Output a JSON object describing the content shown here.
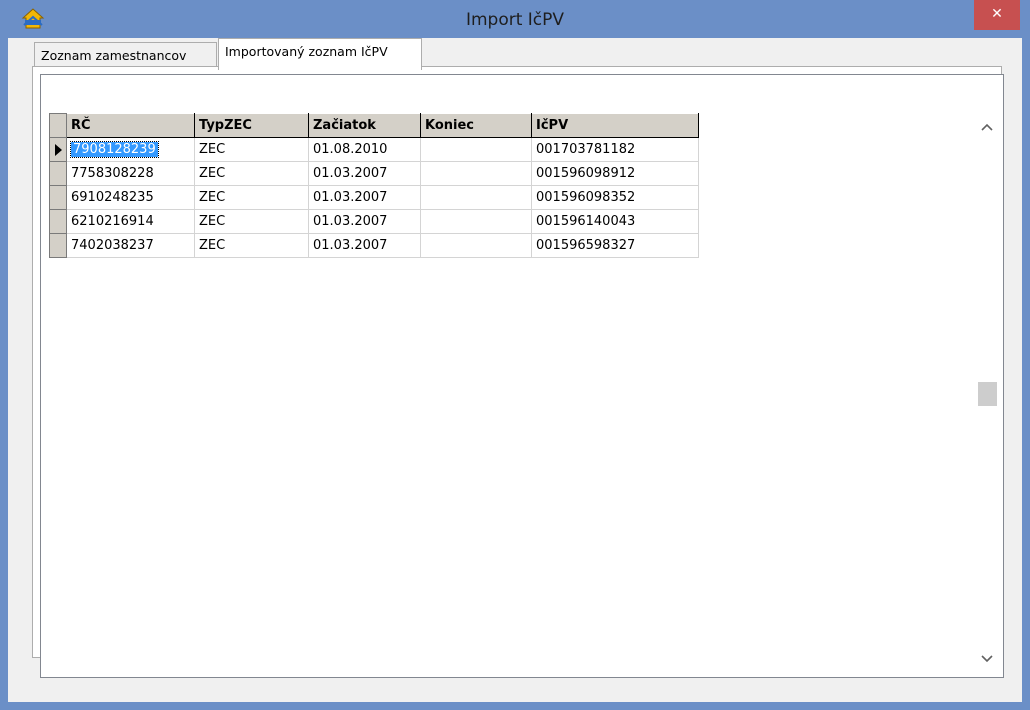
{
  "window": {
    "title": "Import IčPV",
    "close_label": "✕"
  },
  "tabs": [
    {
      "label": "Zoznam zamestnancov",
      "active": false
    },
    {
      "label": "Importovaný zoznam IčPV",
      "active": true
    }
  ],
  "grid": {
    "columns": [
      "RČ",
      "TypZEC",
      "Začiatok",
      "Koniec",
      "IčPV"
    ],
    "rows": [
      [
        "7908128239",
        "ZEC",
        "01.08.2010",
        "",
        "001703781182"
      ],
      [
        "7758308228",
        "ZEC",
        "01.03.2007",
        "",
        "001596098912"
      ],
      [
        "6910248235",
        "ZEC",
        "01.03.2007",
        "",
        "001596098352"
      ],
      [
        "6210216914",
        "ZEC",
        "01.03.2007",
        "",
        "001596140043"
      ],
      [
        "7402038237",
        "ZEC",
        "01.03.2007",
        "",
        "001596598327"
      ]
    ],
    "selected_row": 0
  },
  "scrollbar": {
    "up_icon": "chevron-up-icon",
    "down_icon": "chevron-down-icon"
  },
  "colors": {
    "titlebar": "#6b8fc7",
    "close": "#c75050",
    "selection": "#3399ff",
    "header": "#d4d0c8"
  }
}
